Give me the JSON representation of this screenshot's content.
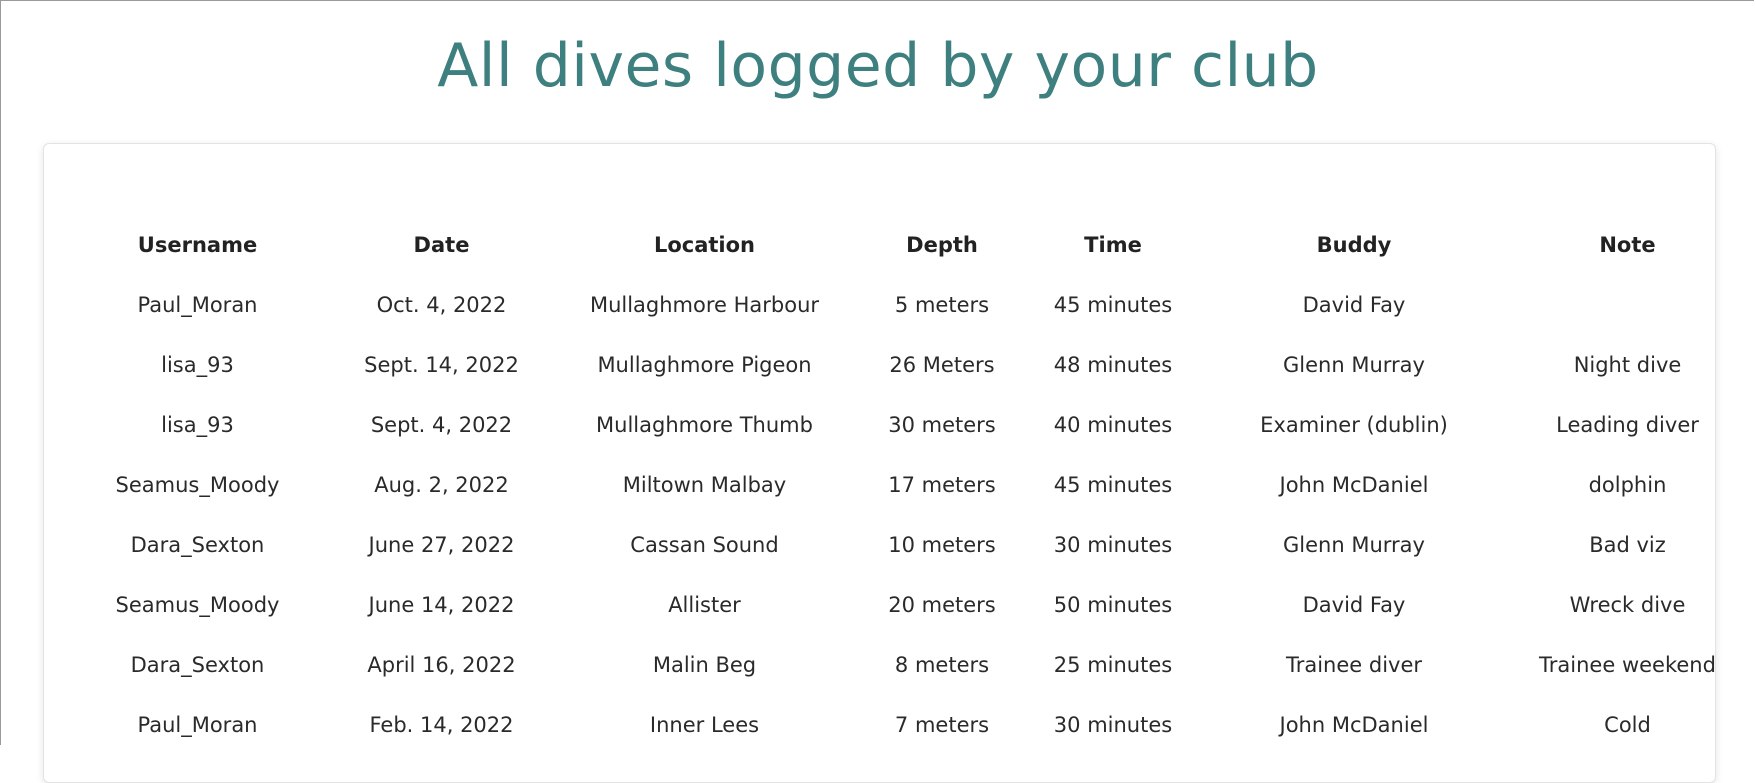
{
  "page": {
    "title": "All dives logged by your club",
    "accent_color": "#3e7f7f"
  },
  "table": {
    "headers": [
      "Username",
      "Date",
      "Location",
      "Depth",
      "Time",
      "Buddy",
      "Note"
    ],
    "rows": [
      [
        "Paul_Moran",
        "Oct. 4, 2022",
        "Mullaghmore Harbour",
        "5 meters",
        "45 minutes",
        "David Fay",
        ""
      ],
      [
        "lisa_93",
        "Sept. 14, 2022",
        "Mullaghmore Pigeon",
        "26 Meters",
        "48 minutes",
        "Glenn Murray",
        "Night dive"
      ],
      [
        "lisa_93",
        "Sept. 4, 2022",
        "Mullaghmore Thumb",
        "30 meters",
        "40 minutes",
        "Examiner (dublin)",
        "Leading diver"
      ],
      [
        "Seamus_Moody",
        "Aug. 2, 2022",
        "Miltown Malbay",
        "17 meters",
        "45 minutes",
        "John McDaniel",
        "dolphin"
      ],
      [
        "Dara_Sexton",
        "June 27, 2022",
        "Cassan Sound",
        "10 meters",
        "30 minutes",
        "Glenn Murray",
        "Bad viz"
      ],
      [
        "Seamus_Moody",
        "June 14, 2022",
        "Allister",
        "20 meters",
        "50 minutes",
        "David Fay",
        "Wreck dive"
      ],
      [
        "Dara_Sexton",
        "April 16, 2022",
        "Malin Beg",
        "8 meters",
        "25 minutes",
        "Trainee diver",
        "Trainee weekend"
      ],
      [
        "Paul_Moran",
        "Feb. 14, 2022",
        "Inner Lees",
        "7 meters",
        "30 minutes",
        "John McDaniel",
        "Cold"
      ]
    ]
  }
}
